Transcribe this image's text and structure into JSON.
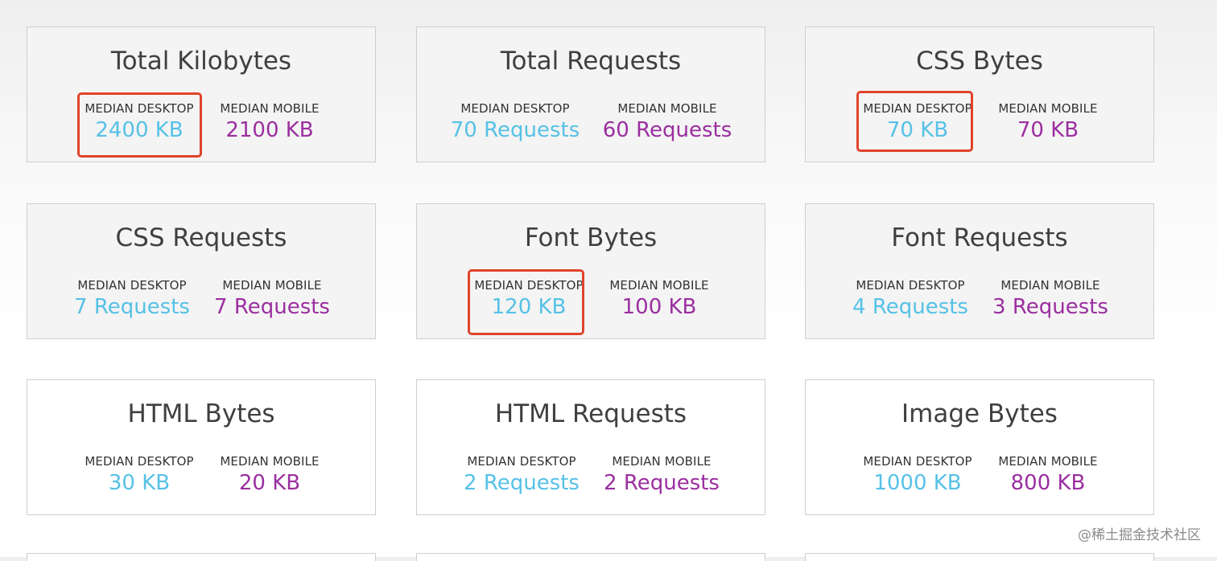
{
  "cards": [
    {
      "title": "Total Kilobytes",
      "desktop_label": "MEDIAN DESKTOP",
      "desktop_value": "2400 KB",
      "mobile_label": "MEDIAN MOBILE",
      "mobile_value": "2100 KB",
      "desktop_highlighted": true
    },
    {
      "title": "Total Requests",
      "desktop_label": "MEDIAN DESKTOP",
      "desktop_value": "70 Requests",
      "mobile_label": "MEDIAN MOBILE",
      "mobile_value": "60 Requests",
      "desktop_highlighted": false
    },
    {
      "title": "CSS Bytes",
      "desktop_label": "MEDIAN DESKTOP",
      "desktop_value": "70 KB",
      "mobile_label": "MEDIAN MOBILE",
      "mobile_value": "70 KB",
      "desktop_highlighted": true
    },
    {
      "title": "CSS Requests",
      "desktop_label": "MEDIAN DESKTOP",
      "desktop_value": "7 Requests",
      "mobile_label": "MEDIAN MOBILE",
      "mobile_value": "7 Requests",
      "desktop_highlighted": false
    },
    {
      "title": "Font Bytes",
      "desktop_label": "MEDIAN DESKTOP",
      "desktop_value": "120 KB",
      "mobile_label": "MEDIAN MOBILE",
      "mobile_value": "100 KB",
      "desktop_highlighted": true
    },
    {
      "title": "Font Requests",
      "desktop_label": "MEDIAN DESKTOP",
      "desktop_value": "4 Requests",
      "mobile_label": "MEDIAN MOBILE",
      "mobile_value": "3 Requests",
      "desktop_highlighted": false
    },
    {
      "title": "HTML Bytes",
      "desktop_label": "MEDIAN DESKTOP",
      "desktop_value": "30 KB",
      "mobile_label": "MEDIAN MOBILE",
      "mobile_value": "20 KB",
      "desktop_highlighted": false
    },
    {
      "title": "HTML Requests",
      "desktop_label": "MEDIAN DESKTOP",
      "desktop_value": "2 Requests",
      "mobile_label": "MEDIAN MOBILE",
      "mobile_value": "2 Requests",
      "desktop_highlighted": false
    },
    {
      "title": "Image Bytes",
      "desktop_label": "MEDIAN DESKTOP",
      "desktop_value": "1000 KB",
      "mobile_label": "MEDIAN MOBILE",
      "mobile_value": "800 KB",
      "desktop_highlighted": false
    }
  ],
  "watermark": "@稀土掘金技术社区",
  "colors": {
    "desktop_value": "#56c1e6",
    "mobile_value": "#9b2fa0",
    "highlight_border": "#e0432b",
    "card_border": "#cfcfcf",
    "title_text": "#3f3f3f"
  }
}
